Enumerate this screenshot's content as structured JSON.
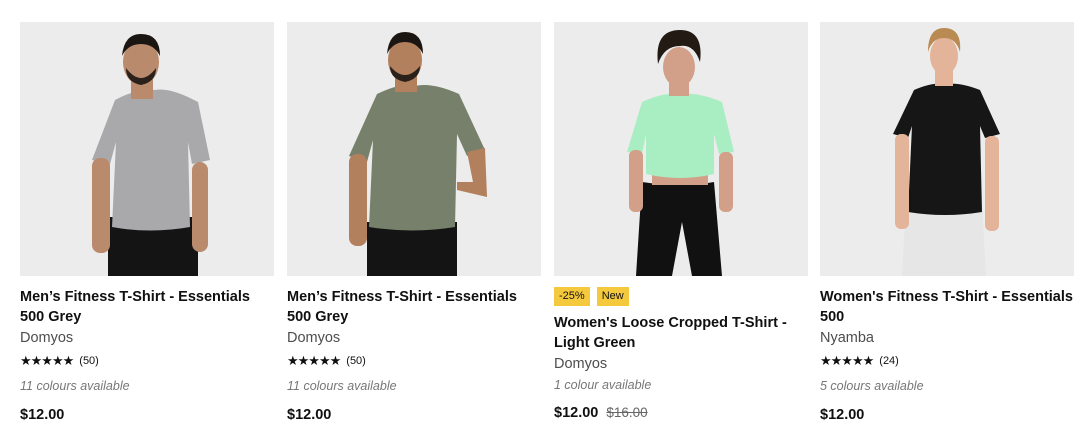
{
  "products": [
    {
      "title": "Men’s Fitness T-Shirt - Essentials 500 Grey",
      "brand": "Domyos",
      "stars": "★★★★★",
      "rating_value": 4.5,
      "review_count": "(50)",
      "colours": "11 colours available",
      "price": "$12.00",
      "image_icon": "person-grey-tshirt-image",
      "colors": {
        "skin": "#b98a6c",
        "shirt": "#a9a9ab",
        "pants": "#141414",
        "hair": "#1c1612"
      }
    },
    {
      "title": "Men’s Fitness T-Shirt - Essentials 500 Grey",
      "brand": "Domyos",
      "stars": "★★★★★",
      "rating_value": 4.5,
      "review_count": "(50)",
      "colours": "11 colours available",
      "price": "$12.00",
      "image_icon": "person-khaki-tshirt-image",
      "colors": {
        "skin": "#b3805e",
        "shirt": "#76806a",
        "pants": "#141414",
        "hair": "#1c1612"
      }
    },
    {
      "badges": [
        "-25%",
        "New"
      ],
      "title": "Women's Loose Cropped T-Shirt - Light Green",
      "brand": "Domyos",
      "colours": "1 colour available",
      "price": "$12.00",
      "old_price": "$16.00",
      "image_icon": "person-green-crop-tshirt-image",
      "colors": {
        "skin": "#d2a088",
        "shirt": "#a9eec2",
        "pants": "#111111",
        "hair": "#231a14"
      }
    },
    {
      "title": "Women's Fitness T-Shirt - Essentials 500",
      "brand": "Nyamba",
      "stars": "★★★★★",
      "rating_value": 4.5,
      "review_count": "(24)",
      "colours": "5 colours available",
      "price": "$12.00",
      "image_icon": "person-black-tshirt-image",
      "colors": {
        "skin": "#e3b49a",
        "shirt": "#161616",
        "pants": "#e6e6e6",
        "hair": "#b98a52"
      }
    }
  ],
  "badge_color": "#f5c93e"
}
